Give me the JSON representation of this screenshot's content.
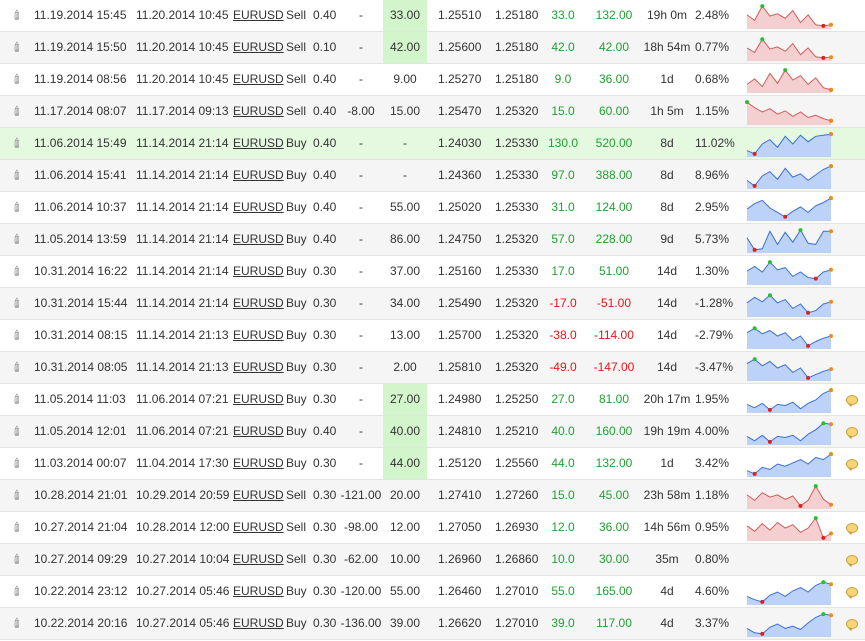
{
  "colors": {
    "profit": "#22a032",
    "loss": "#e01818",
    "highlight_row": "#e5f9e0",
    "tp_highlight": "#d3f5cc",
    "spark_buy_fill": "#bcd3f7",
    "spark_buy_line": "#3b6fd8",
    "spark_sell_fill": "#f4cfcf",
    "spark_sell_line": "#d45a5a"
  },
  "icons": {
    "attachment": "paperclip-icon",
    "comment": "comment-bubble-icon"
  },
  "trades": [
    {
      "open": "11.19.2014 15:45",
      "close": "11.20.2014 10:45",
      "symbol": "EURUSD",
      "type": "Sell",
      "lots": "0.40",
      "sl": "-",
      "tp": "33.00",
      "open_price": "1.25510",
      "close_price": "1.25180",
      "pips": "33.0",
      "profit": "132.00",
      "duration": "19h 0m",
      "gain": "2.48%",
      "has_comment": false,
      "tp_green": true,
      "highlight": false,
      "sign": "pos",
      "spark": [
        0.55,
        0.3,
        0.95,
        0.5,
        0.6,
        0.4,
        0.75,
        0.2,
        0.55,
        0.1,
        0.05,
        0.1
      ]
    },
    {
      "open": "11.19.2014 15:50",
      "close": "11.20.2014 10:45",
      "symbol": "EURUSD",
      "type": "Sell",
      "lots": "0.10",
      "sl": "-",
      "tp": "42.00",
      "open_price": "1.25600",
      "close_price": "1.25180",
      "pips": "42.0",
      "profit": "42.00",
      "duration": "18h 54m",
      "gain": "0.77%",
      "has_comment": false,
      "tp_green": true,
      "highlight": false,
      "sign": "pos",
      "spark": [
        0.5,
        0.3,
        0.9,
        0.45,
        0.55,
        0.35,
        0.7,
        0.2,
        0.5,
        0.1,
        0.05,
        0.08
      ]
    },
    {
      "open": "11.19.2014 08:56",
      "close": "11.20.2014 10:45",
      "symbol": "EURUSD",
      "type": "Sell",
      "lots": "0.40",
      "sl": "-",
      "tp": "9.00",
      "open_price": "1.25270",
      "close_price": "1.25180",
      "pips": "9.0",
      "profit": "36.00",
      "duration": "1d",
      "gain": "0.68%",
      "has_comment": false,
      "tp_green": false,
      "highlight": false,
      "sign": "pos",
      "spark": [
        0.3,
        0.55,
        0.2,
        0.8,
        0.35,
        0.95,
        0.5,
        0.7,
        0.3,
        0.6,
        0.15,
        0.05
      ]
    },
    {
      "open": "11.17.2014 08:07",
      "close": "11.17.2014 09:13",
      "symbol": "EURUSD",
      "type": "Sell",
      "lots": "0.40",
      "sl": "-8.00",
      "tp": "15.00",
      "open_price": "1.25470",
      "close_price": "1.25320",
      "pips": "15.0",
      "profit": "60.00",
      "duration": "1h 5m",
      "gain": "1.15%",
      "has_comment": false,
      "tp_green": false,
      "highlight": false,
      "sign": "pos",
      "spark": [
        0.95,
        0.7,
        0.5,
        0.65,
        0.4,
        0.55,
        0.3,
        0.5,
        0.25,
        0.35,
        0.2,
        0.1
      ]
    },
    {
      "open": "11.06.2014 15:49",
      "close": "11.14.2014 21:14",
      "symbol": "EURUSD",
      "type": "Buy",
      "lots": "0.40",
      "sl": "-",
      "tp": "-",
      "open_price": "1.24030",
      "close_price": "1.25330",
      "pips": "130.0",
      "profit": "520.00",
      "duration": "8d",
      "gain": "11.02%",
      "has_comment": false,
      "tp_green": false,
      "highlight": true,
      "sign": "pos",
      "spark": [
        0.2,
        0.05,
        0.5,
        0.7,
        0.35,
        0.85,
        0.5,
        0.9,
        0.6,
        0.85,
        0.9,
        0.95
      ]
    },
    {
      "open": "11.06.2014 15:41",
      "close": "11.14.2014 21:14",
      "symbol": "EURUSD",
      "type": "Buy",
      "lots": "0.40",
      "sl": "-",
      "tp": "-",
      "open_price": "1.24360",
      "close_price": "1.25330",
      "pips": "97.0",
      "profit": "388.00",
      "duration": "8d",
      "gain": "8.96%",
      "has_comment": false,
      "tp_green": false,
      "highlight": false,
      "sign": "pos",
      "spark": [
        0.3,
        0.05,
        0.5,
        0.7,
        0.35,
        0.85,
        0.45,
        0.6,
        0.3,
        0.55,
        0.8,
        0.95
      ]
    },
    {
      "open": "11.06.2014 10:37",
      "close": "11.14.2014 21:14",
      "symbol": "EURUSD",
      "type": "Buy",
      "lots": "0.40",
      "sl": "-",
      "tp": "55.00",
      "open_price": "1.25020",
      "close_price": "1.25330",
      "pips": "31.0",
      "profit": "124.00",
      "duration": "8d",
      "gain": "2.95%",
      "has_comment": false,
      "tp_green": false,
      "highlight": false,
      "sign": "pos",
      "spark": [
        0.45,
        0.7,
        0.85,
        0.5,
        0.3,
        0.1,
        0.35,
        0.55,
        0.3,
        0.6,
        0.75,
        0.95
      ]
    },
    {
      "open": "11.05.2014 13:59",
      "close": "11.14.2014 21:14",
      "symbol": "EURUSD",
      "type": "Buy",
      "lots": "0.40",
      "sl": "-",
      "tp": "86.00",
      "open_price": "1.24750",
      "close_price": "1.25320",
      "pips": "57.0",
      "profit": "228.00",
      "duration": "9d",
      "gain": "5.73%",
      "has_comment": false,
      "tp_green": false,
      "highlight": false,
      "sign": "pos",
      "spark": [
        0.6,
        0.05,
        0.1,
        0.9,
        0.3,
        0.85,
        0.4,
        0.95,
        0.35,
        0.3,
        0.9,
        0.9
      ]
    },
    {
      "open": "10.31.2014 16:22",
      "close": "11.14.2014 21:14",
      "symbol": "EURUSD",
      "type": "Buy",
      "lots": "0.30",
      "sl": "-",
      "tp": "37.00",
      "open_price": "1.25160",
      "close_price": "1.25330",
      "pips": "17.0",
      "profit": "51.00",
      "duration": "14d",
      "gain": "1.30%",
      "has_comment": false,
      "tp_green": false,
      "highlight": false,
      "sign": "pos",
      "spark": [
        0.55,
        0.75,
        0.5,
        0.95,
        0.6,
        0.7,
        0.3,
        0.5,
        0.25,
        0.2,
        0.5,
        0.6
      ]
    },
    {
      "open": "10.31.2014 15:44",
      "close": "11.14.2014 21:14",
      "symbol": "EURUSD",
      "type": "Buy",
      "lots": "0.30",
      "sl": "-",
      "tp": "34.00",
      "open_price": "1.25490",
      "close_price": "1.25320",
      "pips": "-17.0",
      "profit": "-51.00",
      "duration": "14d",
      "gain": "-1.28%",
      "has_comment": false,
      "tp_green": false,
      "highlight": false,
      "sign": "neg",
      "spark": [
        0.55,
        0.8,
        0.6,
        0.9,
        0.55,
        0.7,
        0.3,
        0.5,
        0.1,
        0.2,
        0.5,
        0.6
      ]
    },
    {
      "open": "10.31.2014 08:15",
      "close": "11.14.2014 21:13",
      "symbol": "EURUSD",
      "type": "Buy",
      "lots": "0.30",
      "sl": "-",
      "tp": "13.00",
      "open_price": "1.25700",
      "close_price": "1.25320",
      "pips": "-38.0",
      "profit": "-114.00",
      "duration": "14d",
      "gain": "-2.79%",
      "has_comment": false,
      "tp_green": false,
      "highlight": false,
      "sign": "neg",
      "spark": [
        0.65,
        0.85,
        0.6,
        0.75,
        0.5,
        0.65,
        0.3,
        0.5,
        0.05,
        0.25,
        0.4,
        0.5
      ]
    },
    {
      "open": "10.31.2014 08:05",
      "close": "11.14.2014 21:13",
      "symbol": "EURUSD",
      "type": "Buy",
      "lots": "0.30",
      "sl": "-",
      "tp": "2.00",
      "open_price": "1.25810",
      "close_price": "1.25320",
      "pips": "-49.0",
      "profit": "-147.00",
      "duration": "14d",
      "gain": "-3.47%",
      "has_comment": false,
      "tp_green": false,
      "highlight": false,
      "sign": "neg",
      "spark": [
        0.7,
        0.9,
        0.6,
        0.8,
        0.5,
        0.65,
        0.3,
        0.5,
        0.05,
        0.2,
        0.35,
        0.45
      ]
    },
    {
      "open": "11.05.2014 11:03",
      "close": "11.06.2014 07:21",
      "symbol": "EURUSD",
      "type": "Buy",
      "lots": "0.30",
      "sl": "-",
      "tp": "27.00",
      "open_price": "1.24980",
      "close_price": "1.25250",
      "pips": "27.0",
      "profit": "81.00",
      "duration": "20h 17m",
      "gain": "1.95%",
      "has_comment": true,
      "tp_green": true,
      "highlight": false,
      "sign": "pos",
      "spark": [
        0.3,
        0.15,
        0.35,
        0.05,
        0.3,
        0.25,
        0.4,
        0.1,
        0.35,
        0.5,
        0.8,
        0.95
      ]
    },
    {
      "open": "11.05.2014 12:01",
      "close": "11.06.2014 07:21",
      "symbol": "EURUSD",
      "type": "Buy",
      "lots": "0.40",
      "sl": "-",
      "tp": "40.00",
      "open_price": "1.24810",
      "close_price": "1.25210",
      "pips": "40.0",
      "profit": "160.00",
      "duration": "19h 19m",
      "gain": "4.00%",
      "has_comment": true,
      "tp_green": true,
      "highlight": false,
      "sign": "pos",
      "spark": [
        0.3,
        0.1,
        0.35,
        0.05,
        0.3,
        0.25,
        0.35,
        0.1,
        0.4,
        0.6,
        0.9,
        0.85
      ]
    },
    {
      "open": "11.03.2014 00:07",
      "close": "11.04.2014 17:30",
      "symbol": "EURUSD",
      "type": "Buy",
      "lots": "0.30",
      "sl": "-",
      "tp": "44.00",
      "open_price": "1.25120",
      "close_price": "1.25560",
      "pips": "44.0",
      "profit": "132.00",
      "duration": "1d",
      "gain": "3.42%",
      "has_comment": true,
      "tp_green": true,
      "highlight": false,
      "sign": "pos",
      "spark": [
        0.2,
        0.05,
        0.35,
        0.25,
        0.5,
        0.4,
        0.55,
        0.7,
        0.5,
        0.8,
        0.7,
        0.95
      ]
    },
    {
      "open": "10.28.2014 21:01",
      "close": "10.29.2014 20:59",
      "symbol": "EURUSD",
      "type": "Sell",
      "lots": "0.30",
      "sl": "-121.00",
      "tp": "20.00",
      "open_price": "1.27410",
      "close_price": "1.27260",
      "pips": "15.0",
      "profit": "45.00",
      "duration": "23h 58m",
      "gain": "1.18%",
      "has_comment": false,
      "tp_green": false,
      "highlight": false,
      "sign": "pos",
      "spark": [
        0.55,
        0.3,
        0.65,
        0.45,
        0.55,
        0.35,
        0.5,
        0.05,
        0.3,
        0.95,
        0.35,
        0.1
      ]
    },
    {
      "open": "10.27.2014 21:04",
      "close": "10.28.2014 12:00",
      "symbol": "EURUSD",
      "type": "Sell",
      "lots": "0.30",
      "sl": "-98.00",
      "tp": "12.00",
      "open_price": "1.27050",
      "close_price": "1.26930",
      "pips": "12.0",
      "profit": "36.00",
      "duration": "14h 56m",
      "gain": "0.95%",
      "has_comment": true,
      "tp_green": false,
      "highlight": false,
      "sign": "pos",
      "spark": [
        0.6,
        0.35,
        0.7,
        0.4,
        0.75,
        0.5,
        0.65,
        0.3,
        0.5,
        0.95,
        0.05,
        0.25
      ]
    },
    {
      "open": "10.27.2014 09:29",
      "close": "10.27.2014 10:04",
      "symbol": "EURUSD",
      "type": "Sell",
      "lots": "0.30",
      "sl": "-62.00",
      "tp": "10.00",
      "open_price": "1.26960",
      "close_price": "1.26860",
      "pips": "10.0",
      "profit": "30.00",
      "duration": "35m",
      "gain": "0.80%",
      "has_comment": true,
      "tp_green": false,
      "highlight": false,
      "sign": "pos",
      "spark": null
    },
    {
      "open": "10.22.2014 23:12",
      "close": "10.27.2014 05:46",
      "symbol": "EURUSD",
      "type": "Buy",
      "lots": "0.30",
      "sl": "-120.00",
      "tp": "55.00",
      "open_price": "1.26460",
      "close_price": "1.27010",
      "pips": "55.0",
      "profit": "165.00",
      "duration": "4d",
      "gain": "4.60%",
      "has_comment": true,
      "tp_green": false,
      "highlight": false,
      "sign": "pos",
      "spark": [
        0.3,
        0.15,
        0.05,
        0.35,
        0.5,
        0.3,
        0.55,
        0.7,
        0.5,
        0.8,
        0.95,
        0.85
      ]
    },
    {
      "open": "10.22.2014 20:16",
      "close": "10.27.2014 05:46",
      "symbol": "EURUSD",
      "type": "Buy",
      "lots": "0.30",
      "sl": "-136.00",
      "tp": "39.00",
      "open_price": "1.26620",
      "close_price": "1.27010",
      "pips": "39.0",
      "profit": "117.00",
      "duration": "4d",
      "gain": "3.37%",
      "has_comment": true,
      "tp_green": false,
      "highlight": false,
      "sign": "pos",
      "spark": [
        0.3,
        0.1,
        0.05,
        0.35,
        0.5,
        0.3,
        0.4,
        0.25,
        0.55,
        0.8,
        0.95,
        0.9
      ]
    }
  ]
}
